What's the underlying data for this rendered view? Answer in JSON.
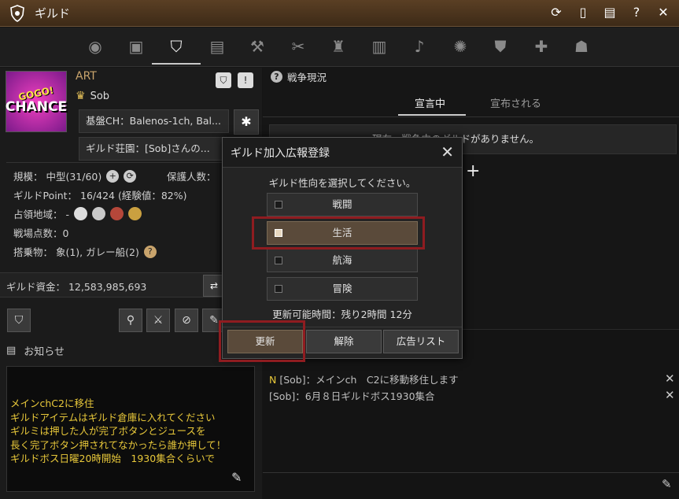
{
  "window": {
    "title": "ギルド"
  },
  "title_controls": [
    "refresh-icon",
    "mobile-icon",
    "document-icon",
    "help-icon",
    "close-icon"
  ],
  "guild": {
    "emblem_text_1": "GOGO!",
    "emblem_text_2": "CHANCE",
    "name": "ART",
    "leader": "Sob",
    "base_ch": "基盤CH：Balenos-1ch, Bal...",
    "manor": "ギルド荘園：[Sob]さんの...",
    "scale": "規模： 中型(31/60)",
    "protect": "保護人数：",
    "points": "ギルドPoint： 16/424 (経験値：82%)",
    "territory": "占領地域： -",
    "battlefield": "戦場点数：0",
    "vehicles": "搭乗物： 象(1), ガレー船(2)",
    "funds": "ギルド資金： 12,583,985,693"
  },
  "notice": {
    "title": "お知らせ",
    "lines": [
      "メインchC2に移住",
      "ギルドアイテムはギルド倉庫に入れてください",
      "ギルミは押した人が完了ボタンとジュースを",
      "長く完了ボタン押されてなかったら誰か押して！",
      "ギルドボス日曜20時開始　1930集合くらいで"
    ]
  },
  "war": {
    "title": "戦争現況",
    "tab_declared": "宣言中",
    "tab_received": "宣布される",
    "empty": "現在、戦争中のギルドがありません。"
  },
  "chat": [
    {
      "prefix": "N",
      "text": "[Sob]：メインch　C2に移動移住します"
    },
    {
      "prefix": "",
      "text": "[Sob]：6月８日ギルドボス1930集合"
    }
  ],
  "modal": {
    "title": "ギルド加入広報登録",
    "prompt": "ギルド性向を選択してください。",
    "options": [
      "戦闘",
      "生活",
      "航海",
      "冒険"
    ],
    "selected_option": "生活",
    "timer": "更新可能時間：残り2時間 12分",
    "btn_update": "更新",
    "btn_cancel": "解除",
    "btn_list": "広告リスト"
  },
  "colors": {
    "accent": "#c9a46c",
    "highlight": "#8f1c20",
    "notice_text": "#e8c83a"
  }
}
